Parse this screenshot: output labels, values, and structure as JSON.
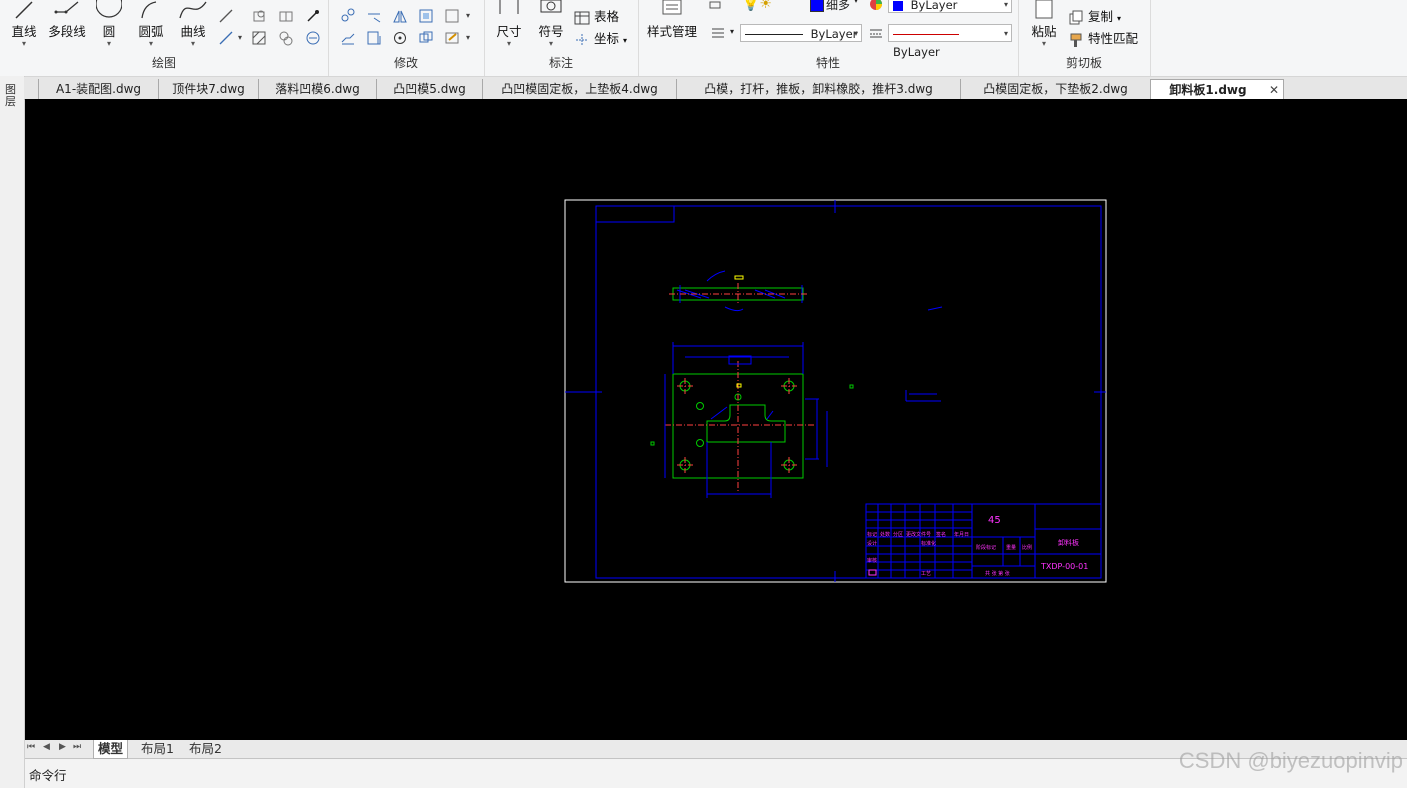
{
  "ribbon": {
    "draw": {
      "title": "绘图",
      "line": "直线",
      "polyline": "多段线",
      "circle": "圆",
      "arc": "圆弧",
      "curve": "曲线"
    },
    "modify": {
      "title": "修改"
    },
    "annotate": {
      "title": "标注",
      "dimension": "尺寸",
      "symbol": "符号",
      "table": "表格",
      "coordinate": "坐标"
    },
    "properties": {
      "title": "特性",
      "style_manager": "样式管理",
      "lineweight_value": "细多",
      "color_value": "ByLayer",
      "linetype_value": "ByLayer",
      "lineweight2_value": "ByLayer",
      "color_swatch": "#0000ff",
      "linetype_color": "#cc0000"
    },
    "clipboard": {
      "title": "剪切板",
      "paste": "粘贴",
      "copy": "复制",
      "match_properties": "特性匹配"
    }
  },
  "left_palette": {
    "label": "图层"
  },
  "tabs": [
    {
      "label": "A1-装配图.dwg"
    },
    {
      "label": "顶件块7.dwg"
    },
    {
      "label": "落料凹模6.dwg"
    },
    {
      "label": "凸凹模5.dwg"
    },
    {
      "label": "凸凹模固定板，上垫板4.dwg"
    },
    {
      "label": "凸模，打杆，推板，卸料橡胶，推杆3.dwg"
    },
    {
      "label": "凸模固定板，下垫板2.dwg"
    },
    {
      "label": "卸料板1.dwg",
      "active": true,
      "close": "✕"
    }
  ],
  "drawing": {
    "material": "45",
    "part_name": "卸料板",
    "drawing_number": "TXDP-00-01",
    "title_block_labels": [
      "标记",
      "处数",
      "分区",
      "更改文件号",
      "签名",
      "年月日",
      "设计",
      "标准化",
      "审核",
      "工艺",
      "阶段标记",
      "重量",
      "比例",
      "共 张 第 张"
    ]
  },
  "layout_tabs": [
    {
      "label": "模型",
      "active": true
    },
    {
      "label": "布局1"
    },
    {
      "label": "布局2"
    }
  ],
  "nav_arrows": [
    "⏮",
    "◀",
    "▶",
    "⏭"
  ],
  "command_line": {
    "label": "命令行"
  },
  "watermark": "CSDN @biyezuopinvip"
}
